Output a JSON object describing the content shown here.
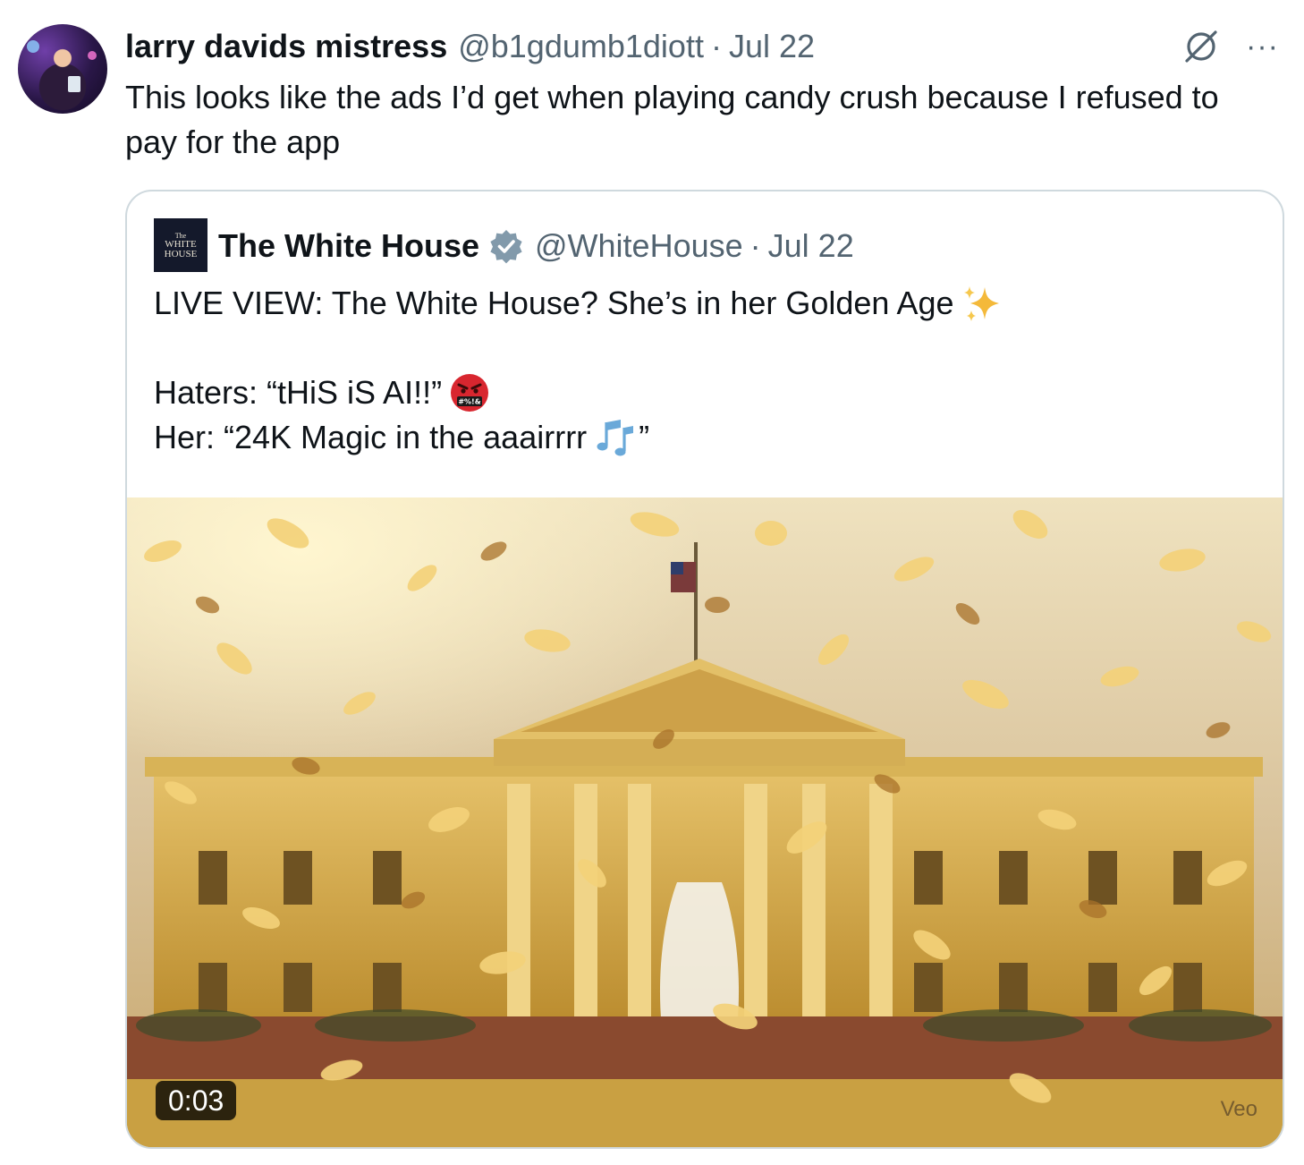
{
  "tweet": {
    "display_name": "larry davids mistress",
    "handle": "@b1gdumb1diott",
    "separator": "·",
    "date": "Jul 22",
    "text": "This looks like the ads I’d get when playing candy crush because I refused to pay for the app",
    "icons": {
      "grok": "grok-icon",
      "more": "more-icon"
    },
    "more_label": "···"
  },
  "quote": {
    "avatar_lines": [
      "The",
      "WHITE",
      "HOUSE"
    ],
    "display_name": "The White House",
    "handle": "@WhiteHouse",
    "separator": "·",
    "date": "Jul 22",
    "verified_color": "#829aab",
    "text_line1": "LIVE VIEW: The White House? She’s in her Golden Age",
    "text_line2": "Haters: “tHiS iS AI!!”",
    "text_line3_start": "Her: “24K Magic in the aaairrrr",
    "text_line3_end": "”",
    "emojis": [
      "sparkles-emoji",
      "angry-cursing-face-emoji",
      "musical-notes-emoji"
    ],
    "media": {
      "duration": "0:03",
      "watermark": "Veo"
    }
  },
  "colors": {
    "text_primary": "#0f1419",
    "text_secondary": "#536471",
    "card_border": "#cfd9de"
  }
}
